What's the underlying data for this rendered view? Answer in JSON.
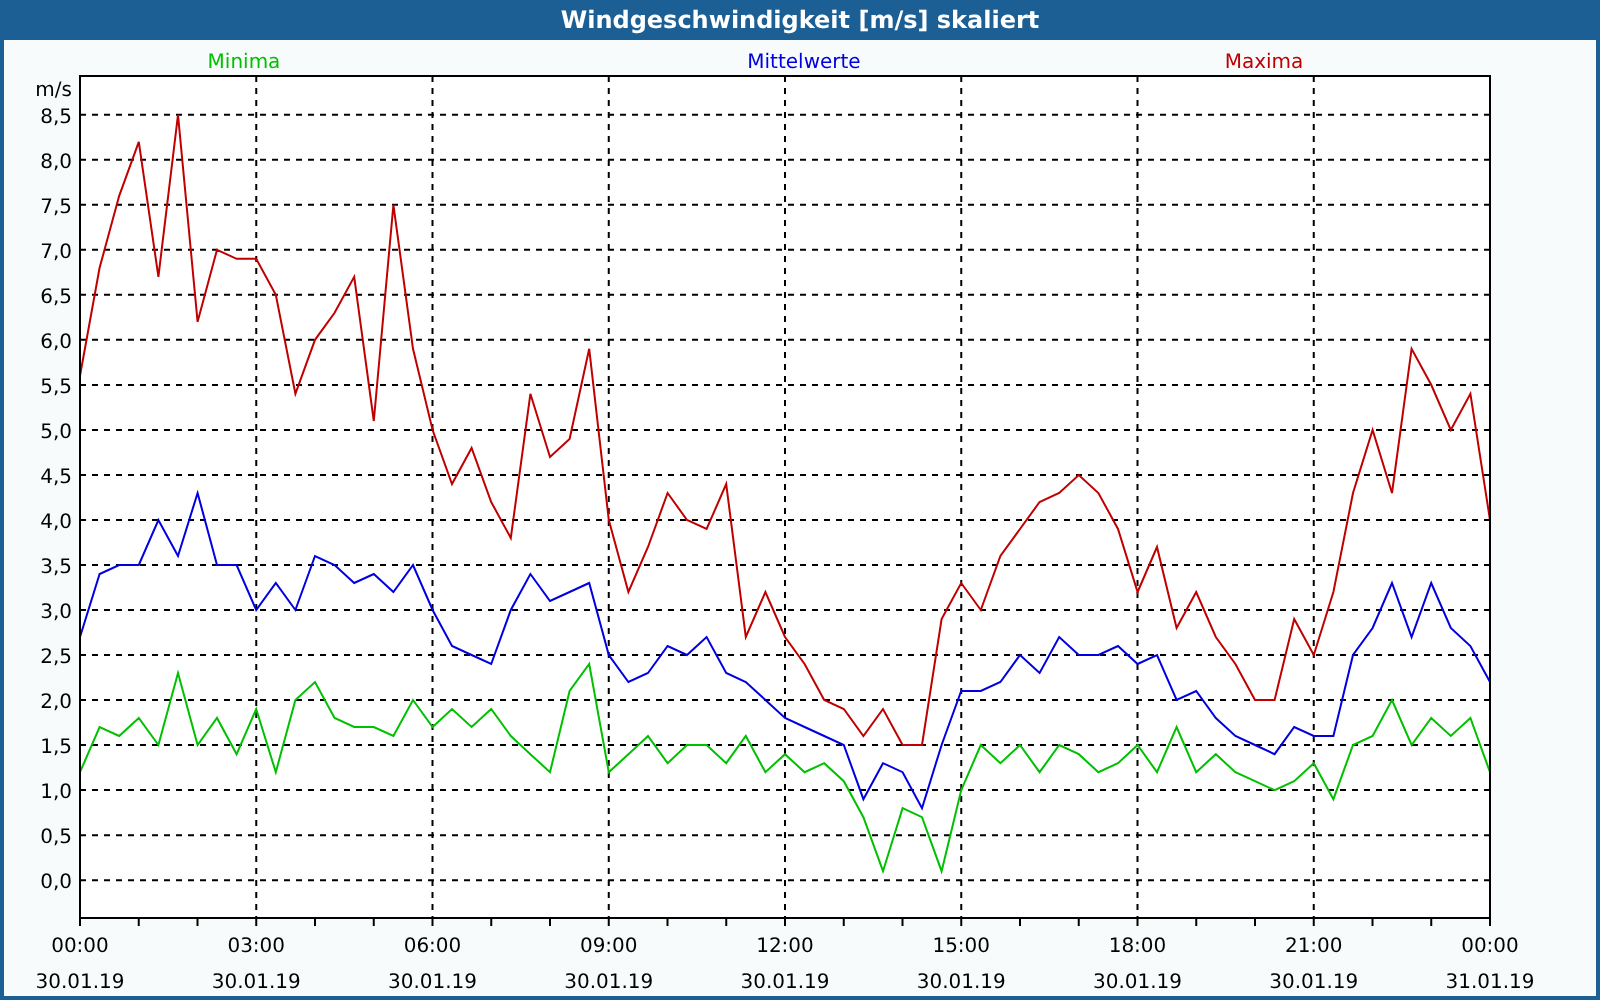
{
  "window": {
    "title": "Windgeschwindigkeit [m/s] skaliert"
  },
  "chart_data": {
    "type": "line",
    "ylabel": "m/s",
    "grid": true,
    "ylim": [
      -0.42,
      8.93
    ],
    "categories": [
      "00:00 30.01.19",
      null,
      null,
      null,
      null,
      null,
      null,
      null,
      null,
      "03:00 30.01.19",
      null,
      null,
      null,
      null,
      null,
      null,
      null,
      null,
      "06:00 30.01.19",
      null,
      null,
      null,
      null,
      null,
      null,
      null,
      null,
      "09:00 30.01.19",
      null,
      null,
      null,
      null,
      null,
      null,
      null,
      null,
      "12:00 30.01.19",
      null,
      null,
      null,
      null,
      null,
      null,
      null,
      null,
      "15:00 30.01.19",
      null,
      null,
      null,
      null,
      null,
      null,
      null,
      null,
      "18:00 30.01.19",
      null,
      null,
      null,
      null,
      null,
      null,
      null,
      null,
      "21:00 30.01.19",
      null,
      null,
      null,
      null,
      null,
      null,
      null,
      null,
      "00:00 31.01.19"
    ],
    "yticks": [
      {
        "value": 0,
        "label": "0,0"
      },
      {
        "value": 0.5,
        "label": "0,5"
      },
      {
        "value": 1,
        "label": "1,0"
      },
      {
        "value": 1.5,
        "label": "1,5"
      },
      {
        "value": 2,
        "label": "2,0"
      },
      {
        "value": 2.5,
        "label": "2,5"
      },
      {
        "value": 3,
        "label": "3,0"
      },
      {
        "value": 3.5,
        "label": "3,5"
      },
      {
        "value": 4,
        "label": "4,0"
      },
      {
        "value": 4.5,
        "label": "4,5"
      },
      {
        "value": 5,
        "label": "5,0"
      },
      {
        "value": 5.5,
        "label": "5,5"
      },
      {
        "value": 6,
        "label": "6,0"
      },
      {
        "value": 6.5,
        "label": "6,5"
      },
      {
        "value": 7,
        "label": "7,0"
      },
      {
        "value": 7.5,
        "label": "7,5"
      },
      {
        "value": 8,
        "label": "8,0"
      },
      {
        "value": 8.5,
        "label": "8,5"
      }
    ],
    "series": [
      {
        "name": "Minima",
        "color": "#00c000",
        "values": [
          1.2,
          1.7,
          1.6,
          1.8,
          1.5,
          2.3,
          1.5,
          1.8,
          1.4,
          1.9,
          1.2,
          2.0,
          2.2,
          1.8,
          1.7,
          1.7,
          1.6,
          2.0,
          1.7,
          1.9,
          1.7,
          1.9,
          1.6,
          1.4,
          1.2,
          2.1,
          2.4,
          1.2,
          1.4,
          1.6,
          1.3,
          1.5,
          1.5,
          1.3,
          1.6,
          1.2,
          1.4,
          1.2,
          1.3,
          1.1,
          0.7,
          0.1,
          0.8,
          0.7,
          0.1,
          1.0,
          1.5,
          1.3,
          1.5,
          1.2,
          1.5,
          1.4,
          1.2,
          1.3,
          1.5,
          1.2,
          1.7,
          1.2,
          1.4,
          1.2,
          1.1,
          1.0,
          1.1,
          1.3,
          0.9,
          1.5,
          1.6,
          2.0,
          1.5,
          1.8,
          1.6,
          1.8,
          1.2
        ]
      },
      {
        "name": "Mittelwerte",
        "color": "#0000e0",
        "values": [
          2.7,
          3.4,
          3.5,
          3.5,
          4.0,
          3.6,
          4.3,
          3.5,
          3.5,
          3.0,
          3.3,
          3.0,
          3.6,
          3.5,
          3.3,
          3.4,
          3.2,
          3.5,
          3.0,
          2.6,
          2.5,
          2.4,
          3.0,
          3.4,
          3.1,
          3.2,
          3.3,
          2.5,
          2.2,
          2.3,
          2.6,
          2.5,
          2.7,
          2.3,
          2.2,
          2.0,
          1.8,
          1.7,
          1.6,
          1.5,
          0.9,
          1.3,
          1.2,
          0.8,
          1.5,
          2.1,
          2.1,
          2.2,
          2.5,
          2.3,
          2.7,
          2.5,
          2.5,
          2.6,
          2.4,
          2.5,
          2.0,
          2.1,
          1.8,
          1.6,
          1.5,
          1.4,
          1.7,
          1.6,
          1.6,
          2.5,
          2.8,
          3.3,
          2.7,
          3.3,
          2.8,
          2.6,
          2.2
        ]
      },
      {
        "name": "Maxima",
        "color": "#c00000",
        "values": [
          5.6,
          6.8,
          7.6,
          8.2,
          6.7,
          8.5,
          6.2,
          7.0,
          6.9,
          6.9,
          6.5,
          5.4,
          6.0,
          6.3,
          6.7,
          5.1,
          7.5,
          5.9,
          5.0,
          4.4,
          4.8,
          4.2,
          3.8,
          5.4,
          4.7,
          4.9,
          5.9,
          4.0,
          3.2,
          3.7,
          4.3,
          4.0,
          3.9,
          4.4,
          2.7,
          3.2,
          2.7,
          2.4,
          2.0,
          1.9,
          1.6,
          1.9,
          1.5,
          1.5,
          2.9,
          3.3,
          3.0,
          3.6,
          3.9,
          4.2,
          4.3,
          4.5,
          4.3,
          3.9,
          3.2,
          3.7,
          2.8,
          3.2,
          2.7,
          2.4,
          2.0,
          2.0,
          2.9,
          2.5,
          3.2,
          4.3,
          5.0,
          4.3,
          5.9,
          5.5,
          5.0,
          5.4,
          4.0
        ]
      }
    ]
  }
}
